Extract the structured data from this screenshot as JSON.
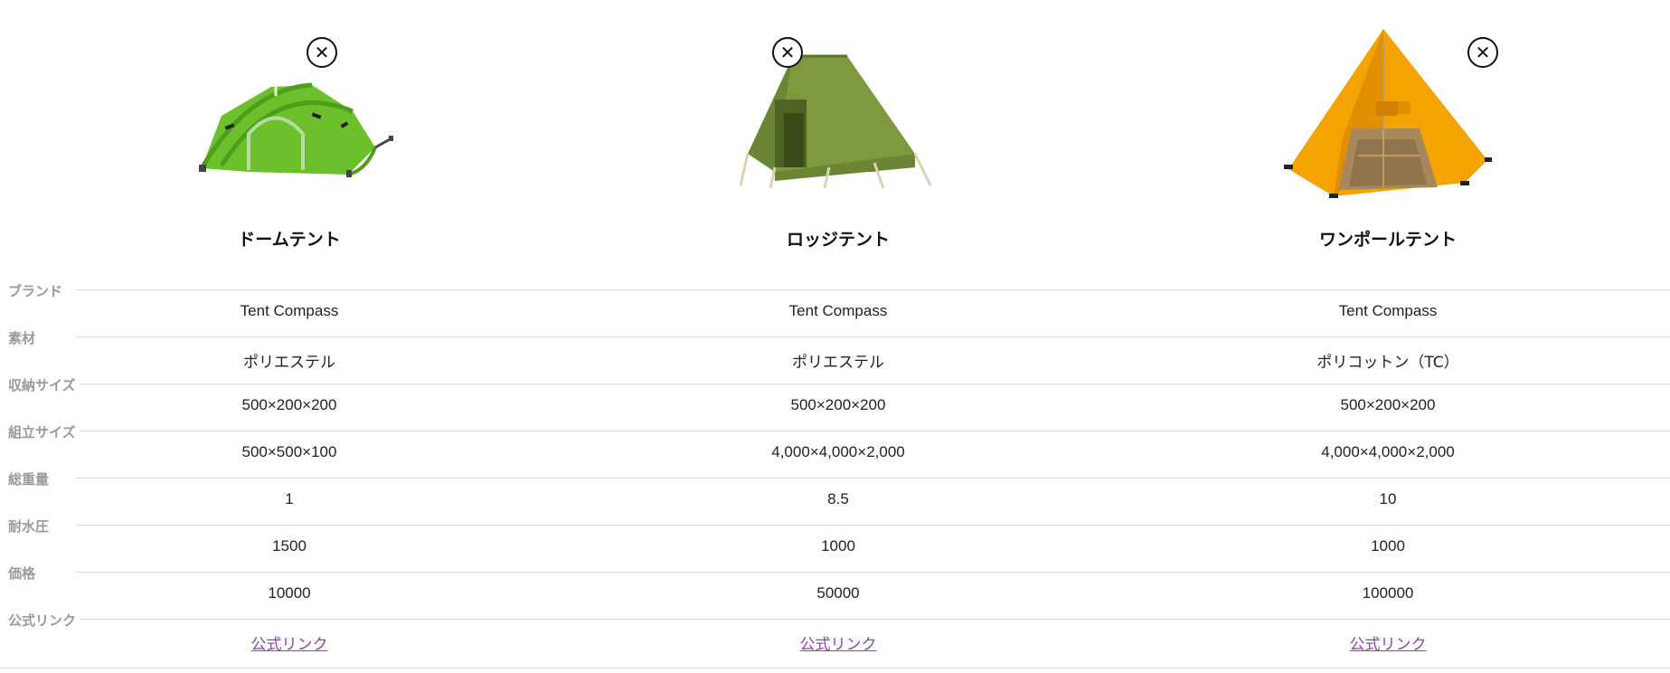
{
  "products": [
    {
      "name": "ドームテント",
      "image_icon": "dome-tent-icon",
      "remove_icon": "close-icon"
    },
    {
      "name": "ロッジテント",
      "image_icon": "lodge-tent-icon",
      "remove_icon": "close-icon"
    },
    {
      "name": "ワンポールテント",
      "image_icon": "one-pole-tent-icon",
      "remove_icon": "close-icon"
    }
  ],
  "rows": [
    {
      "label": "ブランド",
      "values": [
        "Tent Compass",
        "Tent Compass",
        "Tent Compass"
      ]
    },
    {
      "label": "素材",
      "values": [
        "ポリエステル",
        "ポリエステル",
        "ポリコットン（TC）"
      ]
    },
    {
      "label": "収納サイズ",
      "values": [
        "500×200×200",
        "500×200×200",
        "500×200×200"
      ]
    },
    {
      "label": "組立サイズ",
      "values": [
        "500×500×100",
        "4,000×4,000×2,000",
        "4,000×4,000×2,000"
      ]
    },
    {
      "label": "総重量",
      "values": [
        "1",
        "8.5",
        "10"
      ]
    },
    {
      "label": "耐水圧",
      "values": [
        "1500",
        "1000",
        "1000"
      ]
    },
    {
      "label": "価格",
      "values": [
        "10000",
        "50000",
        "100000"
      ]
    },
    {
      "label": "公式リンク",
      "values": [
        "公式リンク",
        "公式リンク",
        "公式リンク"
      ]
    }
  ],
  "colors": {
    "label_gray": "#9a9a9a",
    "divider": "#dcdcdc",
    "link_purple": "#8e44ad",
    "dome_green": "#6cc02c",
    "lodge_olive": "#7f9a3e",
    "pole_orange": "#f4a300"
  }
}
